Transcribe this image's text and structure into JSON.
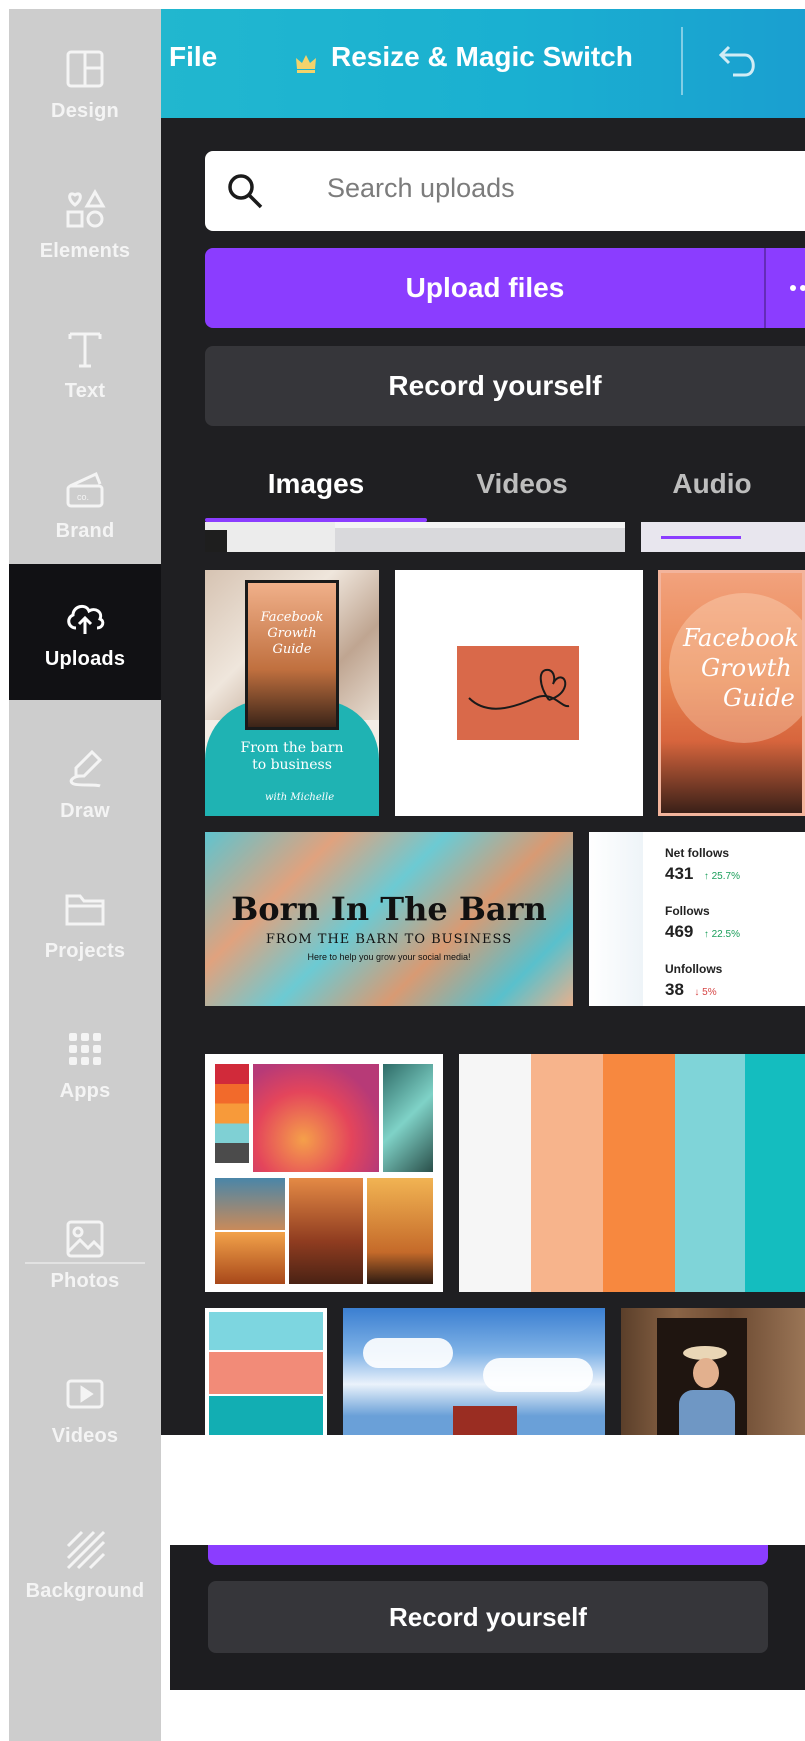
{
  "sidebar": {
    "items": [
      {
        "label": "Design",
        "icon": "layout-icon"
      },
      {
        "label": "Elements",
        "icon": "shapes-icon"
      },
      {
        "label": "Text",
        "icon": "text-icon"
      },
      {
        "label": "Brand",
        "icon": "brand-icon"
      },
      {
        "label": "Uploads",
        "icon": "cloud-upload-icon",
        "active": true
      },
      {
        "label": "Draw",
        "icon": "draw-icon"
      },
      {
        "label": "Projects",
        "icon": "folder-icon"
      },
      {
        "label": "Apps",
        "icon": "apps-grid-icon"
      },
      {
        "label": "Photos",
        "icon": "image-icon"
      },
      {
        "label": "Videos",
        "icon": "video-icon"
      },
      {
        "label": "Background",
        "icon": "background-icon"
      }
    ]
  },
  "header": {
    "file_label": "File",
    "resize_label": "Resize & Magic Switch"
  },
  "uploads": {
    "search_placeholder": "Search uploads",
    "upload_label": "Upload files",
    "record_label": "Record yourself",
    "tabs": [
      {
        "label": "Images",
        "active": true
      },
      {
        "label": "Videos",
        "active": false
      },
      {
        "label": "Audio",
        "active": false
      }
    ]
  },
  "thumbnails": {
    "guide_small": {
      "line1": "Facebook",
      "line2": "Growth",
      "line3": "Guide",
      "caption1": "From the barn",
      "caption2": "to business",
      "signature": "with Michelle"
    },
    "guide_large": {
      "line1": "Facebook",
      "line2": "Growth",
      "line3": "Guide"
    },
    "banner": {
      "title": "Born In The Barn",
      "subtitle": "FROM THE BARN TO BUSINESS",
      "tagline": "Here to help you grow your social media!"
    },
    "stats": [
      {
        "label": "Net follows",
        "value": "431",
        "change": "↑ 25.7%",
        "color": "#1a9e5a"
      },
      {
        "label": "Follows",
        "value": "469",
        "change": "↑ 22.5%",
        "color": "#1a9e5a"
      },
      {
        "label": "Unfollows",
        "value": "38",
        "change": "↓ 5%",
        "color": "#d64545"
      }
    ],
    "palette_colors": [
      "#f6f6f6",
      "#f7b48c",
      "#f7883f",
      "#7fd4d8",
      "#14bdbf"
    ],
    "small_palette_colors": [
      "#7dd6e0",
      "#f28b78",
      "#12aeb3"
    ]
  },
  "lower_panel": {
    "record_label": "Record yourself"
  },
  "colors": {
    "accent": "#8b3dff",
    "header_teal": "#1ab0d1",
    "panel_bg": "#1f1f22"
  }
}
